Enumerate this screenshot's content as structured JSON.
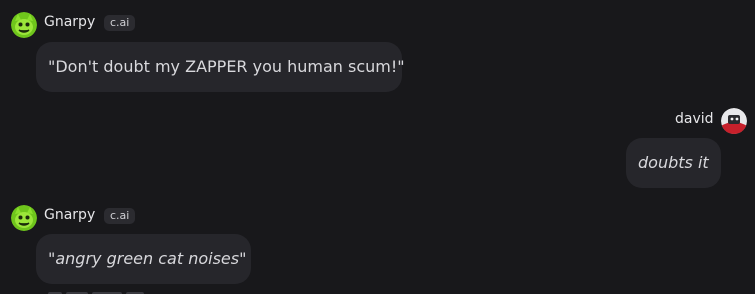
{
  "messages": [
    {
      "sender": "Gnarpy",
      "badge": "c.ai",
      "text": "\"Don't doubt my ZAPPER you human scum!\""
    },
    {
      "sender": "david",
      "text": "doubts it"
    },
    {
      "sender": "Gnarpy",
      "badge": "c.ai",
      "quote_open": "\"",
      "text_italic": "angry green cat noises",
      "quote_close": "\""
    }
  ],
  "colors": {
    "background": "#18181b",
    "bubble": "#26262b",
    "bot_avatar": "#7dd321",
    "user_avatar_accent": "#c7202b"
  },
  "icons": {
    "bot_avatar": "green-cat-avatar-icon",
    "user_avatar": "user-avatar-icon"
  }
}
